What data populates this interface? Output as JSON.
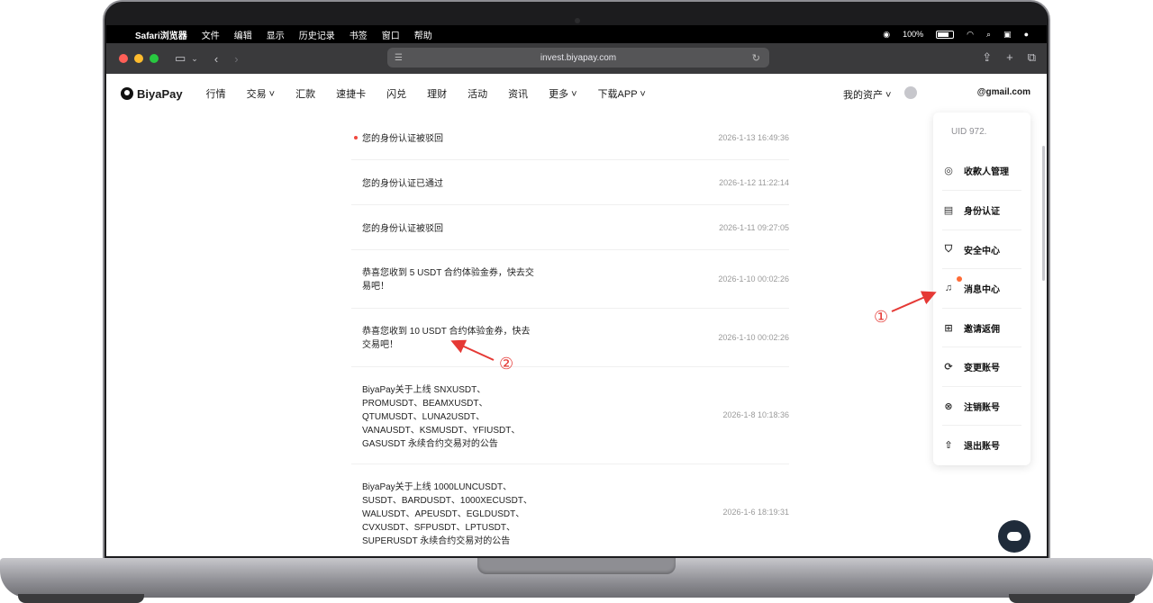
{
  "menubar": {
    "items": [
      "Safari浏览器",
      "文件",
      "编辑",
      "显示",
      "历史记录",
      "书签",
      "窗口",
      "帮助"
    ],
    "battery": "100%"
  },
  "browser": {
    "url": "invest.biyapay.com"
  },
  "site": {
    "logo": "BiyaPay",
    "nav": [
      "行情",
      "交易 ˅",
      "汇款",
      "速捷卡",
      "闪兑",
      "理财",
      "活动",
      "资讯",
      "更多 ˅",
      "下载APP ˅"
    ],
    "assets_label": "我的资产 ˅",
    "email": "@gmail.com"
  },
  "messages": [
    {
      "text": "您的身份认证被驳回",
      "time": "2026-1-13 16:49:36",
      "unread": true
    },
    {
      "text": "您的身份认证已通过",
      "time": "2026-1-12 11:22:14",
      "unread": false
    },
    {
      "text": "您的身份认证被驳回",
      "time": "2026-1-11 09:27:05",
      "unread": false
    },
    {
      "text": "恭喜您收到 5 USDT 合约体验金券，快去交易吧！",
      "time": "2026-1-10 00:02:26",
      "unread": false
    },
    {
      "text": "恭喜您收到 10 USDT 合约体验金券，快去交易吧！",
      "time": "2026-1-10 00:02:26",
      "unread": false
    },
    {
      "text": "BiyaPay关于上线 SNXUSDT、PROMUSDT、BEAMXUSDT、QTUMUSDT、LUNA2USDT、VANAUSDT、KSMUSDT、YFIUSDT、GASUSDT 永续合约交易对的公告",
      "time": "2026-1-8 10:18:36",
      "unread": false
    },
    {
      "text": "BiyaPay关于上线 1000LUNCUSDT、SUSDT、BARDUSDT、1000XECUSDT、WALUSDT、APEUSDT、EGLDUSDT、CVXUSDT、SFPUSDT、LPTUSDT、SUPERUSDT 永续合约交易对的公告",
      "time": "2026-1-6 18:19:31",
      "unread": false
    }
  ],
  "dropdown": {
    "uid": "UID  972.",
    "items": [
      {
        "label": "收款人管理",
        "icon": "user-circle-icon"
      },
      {
        "label": "身份认证",
        "icon": "id-card-icon"
      },
      {
        "label": "安全中心",
        "icon": "shield-icon"
      },
      {
        "label": "消息中心",
        "icon": "bell-icon"
      },
      {
        "label": "邀请返佣",
        "icon": "gift-icon"
      },
      {
        "label": "变更账号",
        "icon": "refresh-icon"
      },
      {
        "label": "注销账号",
        "icon": "close-circle-icon"
      },
      {
        "label": "退出账号",
        "icon": "logout-icon"
      }
    ]
  },
  "annotations": {
    "one": "①",
    "two": "②"
  },
  "colors": {
    "accent_red": "#e53935",
    "unread_dot": "#f0483e",
    "badge": "#ff6b35"
  }
}
